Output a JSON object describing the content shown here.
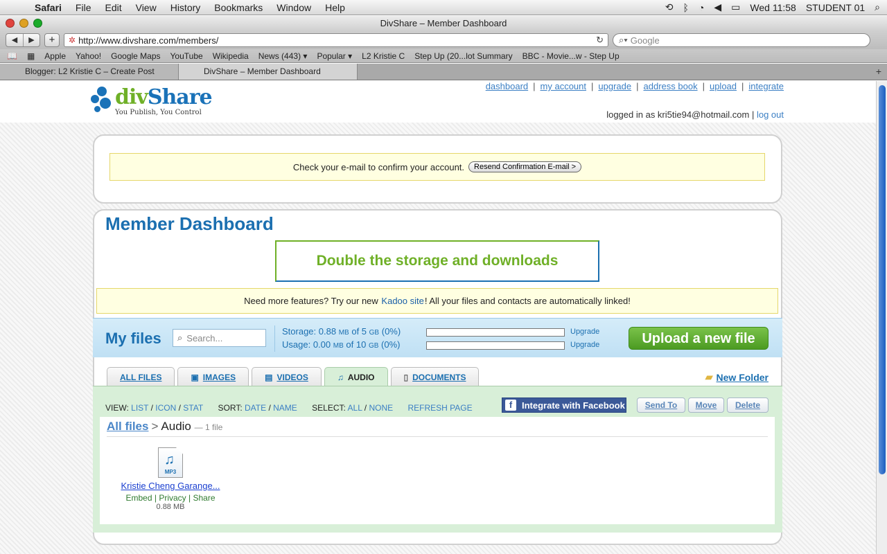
{
  "menubar": {
    "app": "Safari",
    "items": [
      "File",
      "Edit",
      "View",
      "History",
      "Bookmarks",
      "Window",
      "Help"
    ],
    "clock": "Wed 11:58",
    "user": "STUDENT 01"
  },
  "window": {
    "title": "DivShare – Member Dashboard"
  },
  "toolbar": {
    "url": "http://www.divshare.com/members/",
    "search_placeholder": "Google"
  },
  "bookmarks": [
    "Apple",
    "Yahoo!",
    "Google Maps",
    "YouTube",
    "Wikipedia",
    "News (443) ▾",
    "Popular ▾",
    "L2 Kristie C",
    "Step Up (20...lot Summary",
    "BBC - Movie...w - Step Up"
  ],
  "tabs": [
    {
      "label": "Blogger: L2 Kristie C – Create Post"
    },
    {
      "label": "DivShare – Member Dashboard"
    }
  ],
  "site": {
    "logo": {
      "div": "div",
      "share": "Share",
      "tagline": "You Publish, You Control"
    },
    "nav": [
      "dashboard",
      "my account",
      "upgrade",
      "address book",
      "upload",
      "integrate"
    ],
    "logged_in_text": "logged in as kri5tie94@hotmail.com",
    "logout": "log out"
  },
  "confirm": {
    "message": "Check your e-mail to confirm your account.",
    "button": "Resend Confirmation E-mail >"
  },
  "dashboard": {
    "title": "Member Dashboard",
    "promo": "Double the storage and downloads",
    "kadoo": {
      "before": "Need more features? Try our new",
      "link": "Kadoo site",
      "after": "! All your files and contacts are automatically linked!"
    }
  },
  "files_bar": {
    "title": "My files",
    "search_placeholder": "Search...",
    "storage": {
      "label": "Storage:",
      "used": "0.88",
      "used_unit": "MB",
      "of": "of 5",
      "total_unit": "GB",
      "pct": "(0%)",
      "fill": 0
    },
    "usage": {
      "label": "Usage:",
      "used": "0.00",
      "used_unit": "MB",
      "of": "of 10",
      "total_unit": "GB",
      "pct": "(0%)",
      "fill": 0
    },
    "upgrade": "Upgrade",
    "upload_button": "Upload a new file"
  },
  "file_tabs": [
    {
      "label": "ALL FILES"
    },
    {
      "label": "IMAGES"
    },
    {
      "label": "VIDEOS"
    },
    {
      "label": "AUDIO"
    },
    {
      "label": "DOCUMENTS"
    }
  ],
  "new_folder": "New Folder",
  "view_bar": {
    "view_label": "VIEW:",
    "list": "LIST",
    "icon": "ICON",
    "stat": "STAT",
    "sort_label": "SORT:",
    "date": "DATE",
    "name": "NAME",
    "select_label": "SELECT:",
    "all": "ALL",
    "none": "NONE",
    "refresh": "REFRESH PAGE"
  },
  "actions": {
    "facebook": "Integrate with Facebook",
    "send_to": "Send To",
    "move": "Move",
    "delete": "Delete"
  },
  "breadcrumb": {
    "root": "All files",
    "sep": ">",
    "current": "Audio",
    "count": "— 1 file"
  },
  "file": {
    "ext": "MP3",
    "name": "Kristie Cheng Garange...",
    "links": [
      "Embed",
      "Privacy",
      "Share"
    ],
    "size": "0.88 MB"
  },
  "colors": {
    "brand_blue": "#1b6fb0",
    "brand_green": "#6fb027",
    "facebook": "#3b5998"
  }
}
